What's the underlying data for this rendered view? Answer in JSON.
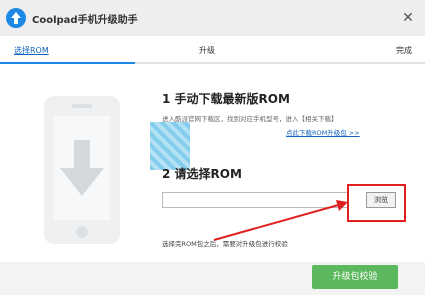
{
  "window": {
    "title": "Coolpad手机升级助手",
    "close_glyph": "✕"
  },
  "steps": [
    {
      "label": "选择ROM"
    },
    {
      "label": "升级"
    },
    {
      "label": "完成"
    }
  ],
  "section1": {
    "heading": "1 手动下载最新版ROM",
    "desc": "进入酷派官网下载区，找到对应手机型号，进入【相关下载】",
    "link": "点此下载ROM升级包 >>"
  },
  "section2": {
    "heading": "2 请选择ROM",
    "file_value": "",
    "browse_label": "浏览",
    "hint": "选择完ROM包之后，需要对升级包进行校验"
  },
  "footer": {
    "upgrade_label": "升级包校验"
  },
  "colors": {
    "accent": "#1e88e5",
    "button_green": "#5cb85c",
    "annotation_red": "#e02020"
  }
}
